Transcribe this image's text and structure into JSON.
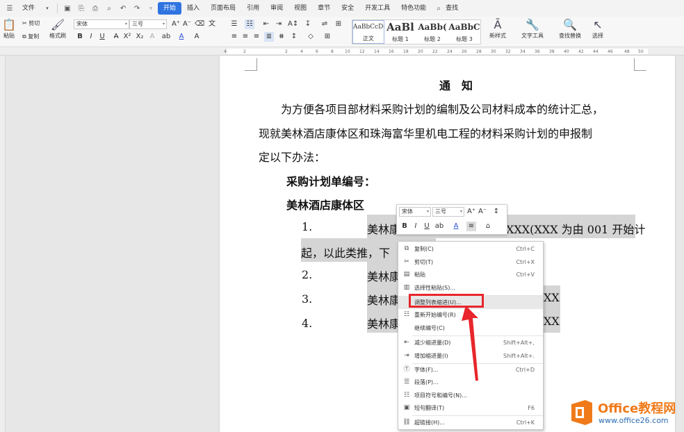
{
  "menu": {
    "file": "文件",
    "tabs": [
      "开始",
      "插入",
      "页面布局",
      "引用",
      "审阅",
      "视图",
      "章节",
      "安全",
      "开发工具",
      "特色功能"
    ],
    "active_tab": "开始",
    "search": "查找"
  },
  "ribbon": {
    "paste": "粘贴",
    "cut": "剪切",
    "copy": "复制",
    "format_painter": "格式刷",
    "font_name": "宋体",
    "font_size": "三号",
    "styles": [
      {
        "preview": "AaBbCcDd",
        "name": "正文"
      },
      {
        "preview": "AaBl",
        "name": "标题 1"
      },
      {
        "preview": "AaBb(",
        "name": "标题 2"
      },
      {
        "preview": "AaBbC",
        "name": "标题 3"
      }
    ],
    "new_style": "新样式",
    "text_tools": "文字工具",
    "find_replace": "查找替换",
    "select": "选择"
  },
  "ruler": {
    "ticks": [
      "4",
      "2",
      "2",
      "4",
      "6",
      "8",
      "10",
      "12",
      "14",
      "16",
      "18",
      "20",
      "22",
      "24",
      "26",
      "28",
      "30",
      "32",
      "34",
      "36",
      "38",
      "40",
      "42",
      "44",
      "46",
      "48",
      "50"
    ]
  },
  "document": {
    "title": "通　知",
    "para1_line1": "为方便各项目部材料采购计划的编制及公司材料成本的统计汇总，",
    "para1_line2": "现就美林酒店康体区和珠海富华里机电工程的材料采购计划的申报制",
    "para1_line3": "定以下办法：",
    "heading1": "采购计划单编号：",
    "heading2": "美林酒店康体区",
    "items": [
      {
        "num": "1.",
        "text_left": "美林康",
        "text_right": "XXX(XXX 为由 001 开始计"
      },
      {
        "num": "",
        "text_left": "起，以此类推，下",
        "text_right": ""
      },
      {
        "num": "2.",
        "text_left": "美林康",
        "text_right": ""
      },
      {
        "num": "3.",
        "text_left": "美林康",
        "text_right": "XX"
      },
      {
        "num": "4.",
        "text_left": "美林康",
        "text_right": "XX"
      }
    ]
  },
  "mini_toolbar": {
    "font_name": "宋体",
    "font_size": "三号"
  },
  "context_menu": {
    "items": [
      {
        "icon": "copy-icon",
        "label": "复制(C)",
        "shortcut": "Ctrl+C"
      },
      {
        "icon": "scissors-icon",
        "label": "剪切(T)",
        "shortcut": "Ctrl+X"
      },
      {
        "icon": "paste-icon",
        "label": "粘贴",
        "shortcut": "Ctrl+V"
      },
      {
        "icon": "paste-special-icon",
        "label": "选择性粘贴(S)...",
        "shortcut": ""
      },
      {
        "icon": "",
        "label": "调整列表缩进(U)...",
        "shortcut": ""
      },
      {
        "icon": "list-restart-icon",
        "label": "重新开始编号(R)",
        "shortcut": ""
      },
      {
        "icon": "",
        "label": "继续编号(C)",
        "shortcut": ""
      },
      {
        "icon": "decrease-indent-icon",
        "label": "减少缩进量(D)",
        "shortcut": "Shift+Alt+,"
      },
      {
        "icon": "increase-indent-icon",
        "label": "增加缩进量(I)",
        "shortcut": "Shift+Alt+."
      },
      {
        "icon": "font-icon",
        "label": "字体(F)...",
        "shortcut": "Ctrl+D"
      },
      {
        "icon": "paragraph-icon",
        "label": "段落(P)...",
        "shortcut": ""
      },
      {
        "icon": "bullets-icon",
        "label": "项目符号和编号(N)...",
        "shortcut": ""
      },
      {
        "icon": "translate-icon",
        "label": "短句翻译(T)",
        "shortcut": "F6"
      },
      {
        "icon": "link-icon",
        "label": "超链接(H)...",
        "shortcut": "Ctrl+K"
      }
    ]
  },
  "watermark": {
    "brand": "Office教程网",
    "url": "www.office26.com"
  },
  "colors": {
    "accent": "#2f74e0",
    "highlight_box": "#e8262b",
    "brand_orange": "#f07a1a"
  }
}
